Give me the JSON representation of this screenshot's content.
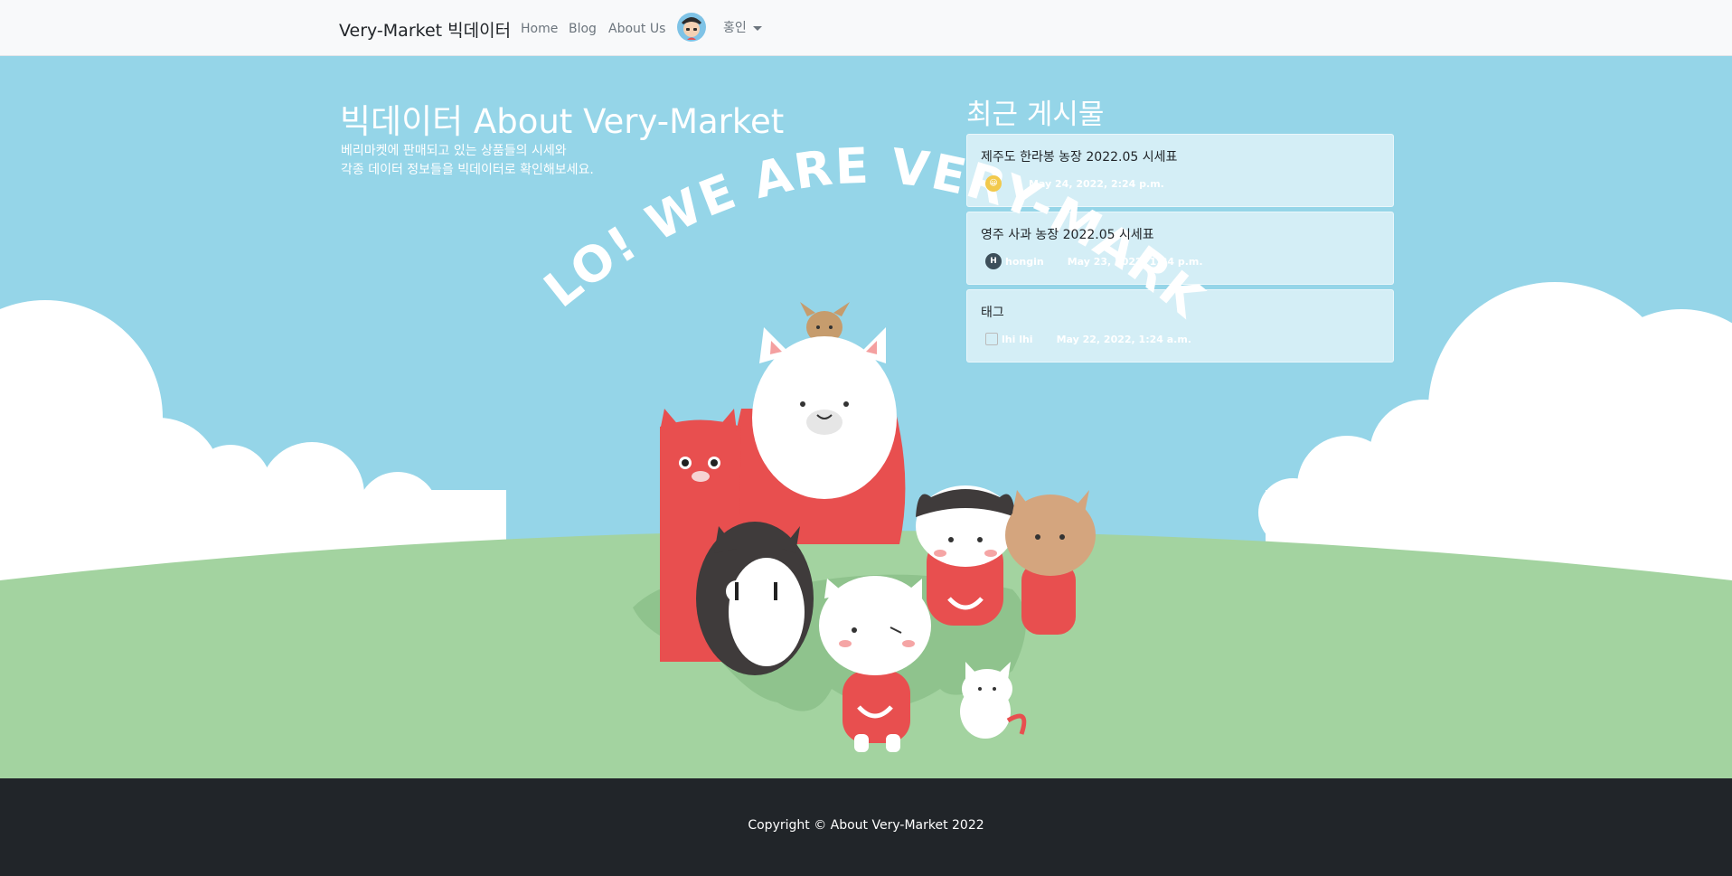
{
  "navbar": {
    "brand": "Very-Market 빅데이터",
    "links": [
      "Home",
      "Blog",
      "About Us"
    ],
    "user_name": "홍인"
  },
  "hero": {
    "title": "빅데이터 About Very-Market",
    "subtitle_line1": "베리마켓에 판매되고 있는 상품들의 시세와",
    "subtitle_line2": "각종 데이터 정보들을 빅데이터로 확인해보세요.",
    "banner_text": "HELLO! WE ARE VERY-MARKET!"
  },
  "recent": {
    "title": "최근 게시물",
    "posts": [
      {
        "title": "제주도 한라봉 농장 2022.05 시세표",
        "author": "",
        "date": "May 24, 2022, 2:24 p.m.",
        "avatar_icon": "user-photo-icon"
      },
      {
        "title": "영주 사과 농장 2022.05 시세표",
        "author": "hongin",
        "date": "May 23, 2022, 1:34 p.m.",
        "avatar_icon": "initial-avatar-icon",
        "avatar_letter": "H"
      },
      {
        "title": "태그",
        "author": "lhi lhi",
        "date": "May 22, 2022, 1:24 a.m.",
        "avatar_icon": "broken-image-icon"
      }
    ]
  },
  "footer": {
    "copyright": "Copyright © About Very-Market 2022"
  },
  "colors": {
    "sky": "#95d5e8",
    "grass": "#a3d3a0",
    "cat_red": "#e84f4f",
    "footer_bg": "#212529"
  }
}
